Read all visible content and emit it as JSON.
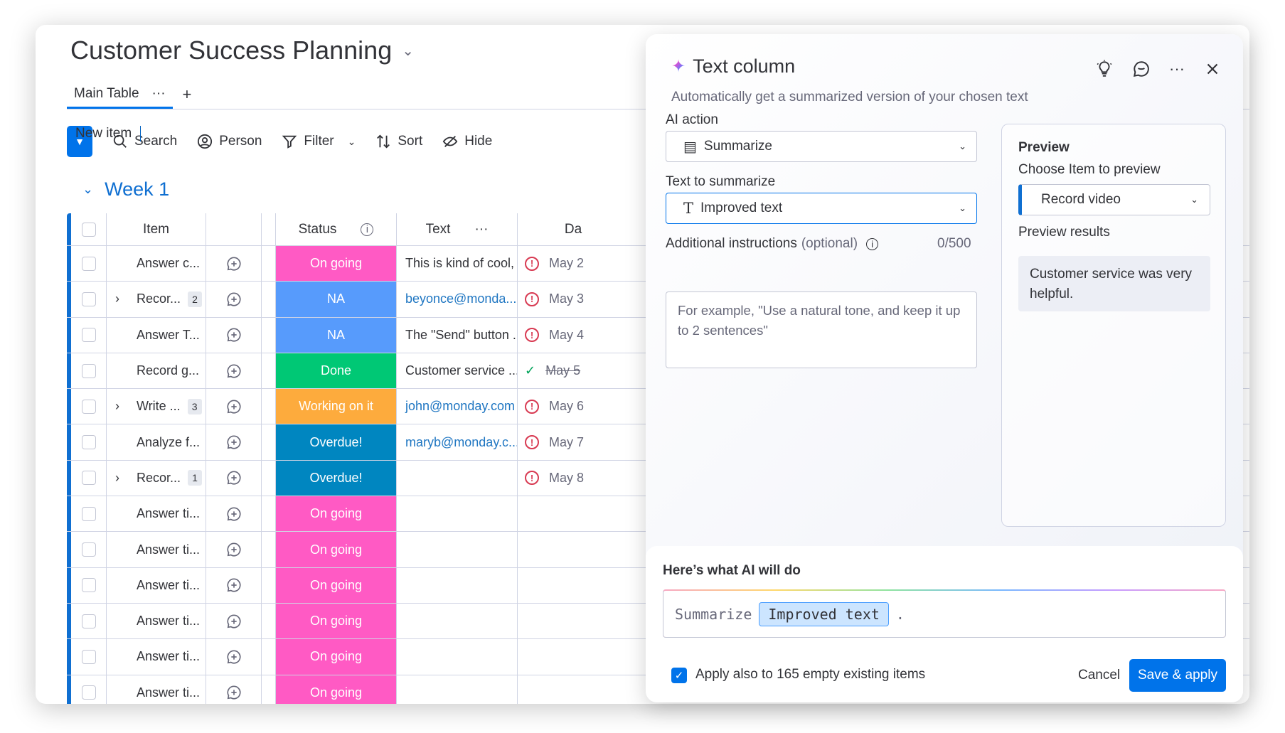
{
  "board": {
    "title": "Customer Success Planning",
    "tabs": [
      {
        "label": "Main Table"
      }
    ],
    "add_tab": "+",
    "toolbar": {
      "new_item": "New item",
      "search": "Search",
      "person": "Person",
      "filter": "Filter",
      "sort": "Sort",
      "hide": "Hide"
    },
    "group": {
      "name": "Week 1",
      "color": "#0f6fd1"
    },
    "columns": {
      "item": "Item",
      "status": "Status",
      "text": "Text",
      "date": "Da"
    },
    "rows": [
      {
        "item": "Answer c...",
        "sub": "",
        "status": "On going",
        "status_color": "#ff5ac4",
        "text": "This is kind of cool, ...",
        "text_link": false,
        "date": "May 2",
        "date_icon": "warn"
      },
      {
        "item": "Recor...",
        "sub": "2",
        "status": "NA",
        "status_color": "#579bfc",
        "text": "beyonce@monda...",
        "text_link": true,
        "date": "May 3",
        "date_icon": "warn"
      },
      {
        "item": "Answer T...",
        "sub": "",
        "status": "NA",
        "status_color": "#579bfc",
        "text": "The \"Send\" button ...",
        "text_link": false,
        "date": "May 4",
        "date_icon": "warn"
      },
      {
        "item": "Record g...",
        "sub": "",
        "status": "Done",
        "status_color": "#00c875",
        "text": "Customer service ...",
        "text_link": false,
        "date": "May 5",
        "date_icon": "check"
      },
      {
        "item": "Write ...",
        "sub": "3",
        "status": "Working on it",
        "status_color": "#fdab3d",
        "text": "john@monday.com",
        "text_link": true,
        "date": "May 6",
        "date_icon": "warn"
      },
      {
        "item": "Analyze f...",
        "sub": "",
        "status": "Overdue!",
        "status_color": "#0086c0",
        "text": "maryb@monday.c...",
        "text_link": true,
        "date": "May 7",
        "date_icon": "warn"
      },
      {
        "item": "Recor...",
        "sub": "1",
        "status": "Overdue!",
        "status_color": "#0086c0",
        "text": "",
        "text_link": false,
        "date": "May 8",
        "date_icon": "warn"
      },
      {
        "item": "Answer ti...",
        "sub": "",
        "status": "On going",
        "status_color": "#ff5ac4",
        "text": "",
        "text_link": false,
        "date": "",
        "date_icon": ""
      },
      {
        "item": "Answer ti...",
        "sub": "",
        "status": "On going",
        "status_color": "#ff5ac4",
        "text": "",
        "text_link": false,
        "date": "",
        "date_icon": ""
      },
      {
        "item": "Answer ti...",
        "sub": "",
        "status": "On going",
        "status_color": "#ff5ac4",
        "text": "",
        "text_link": false,
        "date": "",
        "date_icon": ""
      },
      {
        "item": "Answer ti...",
        "sub": "",
        "status": "On going",
        "status_color": "#ff5ac4",
        "text": "",
        "text_link": false,
        "date": "",
        "date_icon": ""
      },
      {
        "item": "Answer ti...",
        "sub": "",
        "status": "On going",
        "status_color": "#ff5ac4",
        "text": "",
        "text_link": false,
        "date": "",
        "date_icon": ""
      },
      {
        "item": "Answer ti...",
        "sub": "",
        "status": "On going",
        "status_color": "#ff5ac4",
        "text": "",
        "text_link": false,
        "date": "",
        "date_icon": ""
      }
    ]
  },
  "panel": {
    "title": "Text column",
    "subtitle": "Automatically get a summarized version of your chosen text",
    "ai_action_label": "AI action",
    "ai_action_value": "Summarize",
    "text_label": "Text to summarize",
    "text_value": "Improved text",
    "instructions_label": "Additional instructions",
    "instructions_optional": "(optional)",
    "instructions_count": "0/500",
    "instructions_placeholder": "For example, \"Use a natural tone, and keep it up to 2 sentences\"",
    "preview": {
      "heading": "Preview",
      "choose_label": "Choose Item to preview",
      "choose_value": "Record video",
      "results_label": "Preview results",
      "results_text": "Customer service was very helpful."
    },
    "summary_heading": "Here’s what AI will do",
    "summary_verb": "Summarize",
    "summary_token": "Improved text",
    "summary_end": ".",
    "apply_label": "Apply also to 165 empty existing items",
    "cancel": "Cancel",
    "save": "Save & apply"
  }
}
